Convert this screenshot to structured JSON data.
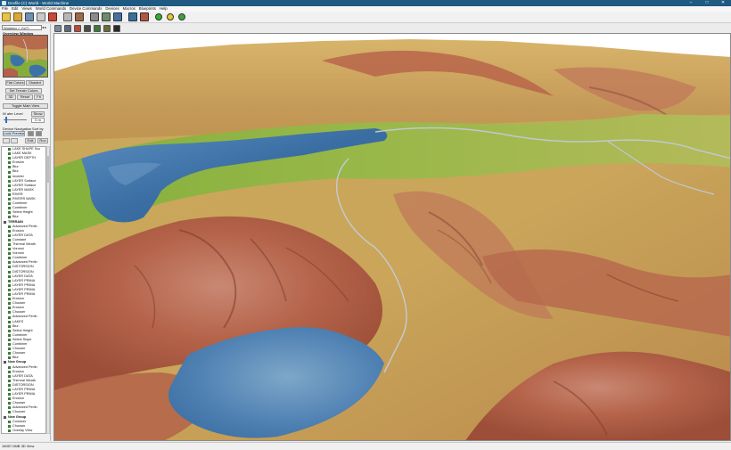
{
  "titlebar": {
    "title": "Devfile (C) World - World Machine",
    "minimize": "–",
    "maximize": "□",
    "close": "✕"
  },
  "menu": [
    "File",
    "Edit",
    "Views",
    "World Commands",
    "Device Commands",
    "Devices",
    "Macros",
    "Blueprints",
    "Help"
  ],
  "left_panel": {
    "workspace": "Working ✓ (h/7)",
    "workspace_arrows": "◂ ▸",
    "overview_label": "Overview Window",
    "flat_colors": "Flat Colors",
    "shaded": "Shaded",
    "set_terrain_colors": "Set Terrain Colors",
    "btn_3d": "3D",
    "btn_reset": "Reset",
    "btn_fit": "Fit",
    "toggle_main_view": "Toggle Main View",
    "water_level_label": "W ater Level",
    "show": "Show",
    "water_level_value": "0 m",
    "device_navigation": "Device Navigation",
    "sort_by": "Sort by",
    "lock_preview": "Lock Preview",
    "edit": "Edit",
    "run": "Run",
    "tree_items": [
      {
        "label": "LAKE SHAPE Scu",
        "group": false
      },
      {
        "label": "LAKE MASK",
        "group": false
      },
      {
        "label": "LAYER DEPTH",
        "group": false
      },
      {
        "label": "Erosion",
        "group": false
      },
      {
        "label": "Blur",
        "group": false
      },
      {
        "label": "Blur",
        "group": false
      },
      {
        "label": "Inverter",
        "group": false
      },
      {
        "label": "LAYER Surface",
        "group": false
      },
      {
        "label": "LAYER Surface",
        "group": false
      },
      {
        "label": "LAYER MASK",
        "group": false
      },
      {
        "label": "RIVER",
        "group": false
      },
      {
        "label": "RIVERS MASK",
        "group": false
      },
      {
        "label": "Combiner",
        "group": false
      },
      {
        "label": "Combiner",
        "group": false
      },
      {
        "label": "Select Height",
        "group": false
      },
      {
        "label": "Blur",
        "group": false
      },
      {
        "label": "TERRAIN",
        "group": true
      },
      {
        "label": "Advanced Perlin",
        "group": false
      },
      {
        "label": "Erosion",
        "group": false
      },
      {
        "label": "LAYER DATA",
        "group": false
      },
      {
        "label": "Constant",
        "group": false
      },
      {
        "label": "Thermal Weath",
        "group": false
      },
      {
        "label": "Voronoi",
        "group": false
      },
      {
        "label": "Voronoi",
        "group": false
      },
      {
        "label": "Combiner",
        "group": false
      },
      {
        "label": "Advanced Perlin",
        "group": false
      },
      {
        "label": "DISTORSION",
        "group": false
      },
      {
        "label": "DISTORSION",
        "group": false
      },
      {
        "label": "LAYER DATA",
        "group": false
      },
      {
        "label": "LAYER PRIMA",
        "group": false
      },
      {
        "label": "LAYER PRIMA",
        "group": false
      },
      {
        "label": "LAYER PRIMA",
        "group": false
      },
      {
        "label": "LAYER PRIMA",
        "group": false
      },
      {
        "label": "Erosion",
        "group": false
      },
      {
        "label": "Chooser",
        "group": false
      },
      {
        "label": "Erosion",
        "group": false
      },
      {
        "label": "Chooser",
        "group": false
      },
      {
        "label": "Advanced Perlin",
        "group": false
      },
      {
        "label": "LAKES",
        "group": false
      },
      {
        "label": "Blur",
        "group": false
      },
      {
        "label": "Select Height",
        "group": false
      },
      {
        "label": "Combiner",
        "group": false
      },
      {
        "label": "Select Slope",
        "group": false
      },
      {
        "label": "Combiner",
        "group": false
      },
      {
        "label": "Chooser",
        "group": false
      },
      {
        "label": "Chooser",
        "group": false
      },
      {
        "label": "Blur",
        "group": false
      },
      {
        "label": "New Group",
        "group": true
      },
      {
        "label": "Advanced Perlin",
        "group": false
      },
      {
        "label": "Erosion",
        "group": false
      },
      {
        "label": "LAYER DATA",
        "group": false
      },
      {
        "label": "Thermal Weath",
        "group": false
      },
      {
        "label": "DISTORSION",
        "group": false
      },
      {
        "label": "LAYER PRIMA",
        "group": false
      },
      {
        "label": "LAYER PRIMA",
        "group": false
      },
      {
        "label": "Erosion",
        "group": false
      },
      {
        "label": "Chooser",
        "group": false
      },
      {
        "label": "Advanced Perlin",
        "group": false
      },
      {
        "label": "Chooser",
        "group": false
      },
      {
        "label": "New Group",
        "group": true
      },
      {
        "label": "Colorizer",
        "group": false
      },
      {
        "label": "Chooser",
        "group": false
      },
      {
        "label": "Overlay View",
        "group": false
      }
    ]
  },
  "statusbar": {
    "text": "16057.0MB 3D View"
  },
  "colors": {
    "titlebar": "#1e5a82",
    "water": "#3d72a8",
    "grass": "#7fae3a",
    "sand": "#c9a657",
    "rock": "#b5604a"
  }
}
